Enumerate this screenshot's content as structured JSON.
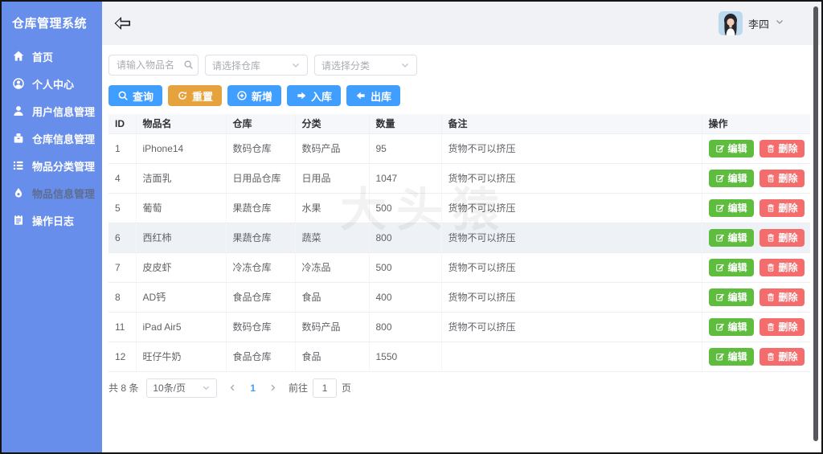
{
  "app_title": "仓库管理系统",
  "sidebar": {
    "items": [
      {
        "label": "首页",
        "icon": "home-icon",
        "active": false
      },
      {
        "label": "个人中心",
        "icon": "user-circle-icon",
        "active": false
      },
      {
        "label": "用户信息管理",
        "icon": "user-icon",
        "active": false
      },
      {
        "label": "仓库信息管理",
        "icon": "warehouse-icon",
        "active": false
      },
      {
        "label": "物品分类管理",
        "icon": "category-list-icon",
        "active": false
      },
      {
        "label": "物品信息管理",
        "icon": "item-drop-icon",
        "active": true
      },
      {
        "label": "操作日志",
        "icon": "log-icon",
        "active": false
      }
    ]
  },
  "topbar": {
    "user_name": "李四"
  },
  "filters": {
    "item_name_placeholder": "请输入物品名",
    "warehouse_placeholder": "请选择仓库",
    "category_placeholder": "请选择分类"
  },
  "toolbar": {
    "query_label": "查询",
    "reset_label": "重置",
    "add_label": "新增",
    "inbound_label": "入库",
    "outbound_label": "出库"
  },
  "table": {
    "columns": [
      "ID",
      "物品名",
      "仓库",
      "分类",
      "数量",
      "备注",
      "操作"
    ],
    "edit_label": "编辑",
    "delete_label": "删除",
    "rows": [
      {
        "id": "1",
        "name": "iPhone14",
        "warehouse": "数码仓库",
        "category": "数码产品",
        "quantity": "95",
        "note": "货物不可以挤压",
        "highlighted": false
      },
      {
        "id": "4",
        "name": "洁面乳",
        "warehouse": "日用品仓库",
        "category": "日用品",
        "quantity": "1047",
        "note": "货物不可以挤压",
        "highlighted": false
      },
      {
        "id": "5",
        "name": "葡萄",
        "warehouse": "果蔬仓库",
        "category": "水果",
        "quantity": "500",
        "note": "货物不可以挤压",
        "highlighted": false
      },
      {
        "id": "6",
        "name": "西红柿",
        "warehouse": "果蔬仓库",
        "category": "蔬菜",
        "quantity": "800",
        "note": "货物不可以挤压",
        "highlighted": true
      },
      {
        "id": "7",
        "name": "皮皮虾",
        "warehouse": "冷冻仓库",
        "category": "冷冻品",
        "quantity": "500",
        "note": "货物不可以挤压",
        "highlighted": false
      },
      {
        "id": "8",
        "name": "AD钙",
        "warehouse": "食品仓库",
        "category": "食品",
        "quantity": "400",
        "note": "货物不可以挤压",
        "highlighted": false
      },
      {
        "id": "11",
        "name": "iPad Air5",
        "warehouse": "数码仓库",
        "category": "数码产品",
        "quantity": "800",
        "note": "货物不可以挤压",
        "highlighted": false
      },
      {
        "id": "12",
        "name": "旺仔牛奶",
        "warehouse": "食品仓库",
        "category": "食品",
        "quantity": "1550",
        "note": "",
        "highlighted": false
      }
    ]
  },
  "pagination": {
    "total_text": "共 8 条",
    "page_size_text": "10条/页",
    "current_page": "1",
    "goto_label": "前往",
    "goto_value": "1",
    "page_unit": "页"
  },
  "watermark_text": "大头猿",
  "colors": {
    "sidebar_bg": "#688eec",
    "primary": "#409eff",
    "warning": "#e6a23c",
    "success": "#5ebd3e",
    "danger": "#f56c6c",
    "table_header_bg": "#f5f7fa",
    "highlight_row_bg": "#eef1f6"
  }
}
